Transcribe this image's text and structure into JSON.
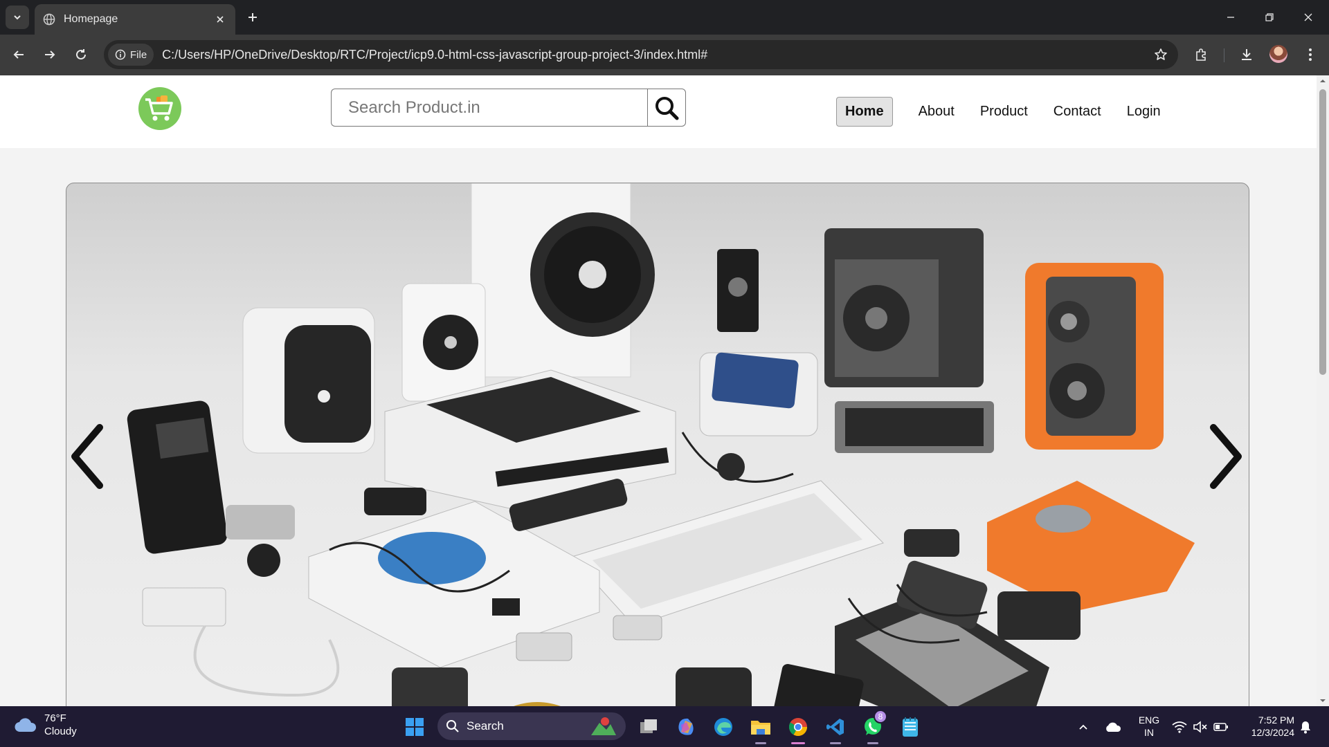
{
  "browser": {
    "tab_title": "Homepage",
    "url_scheme_label": "File",
    "url": "C:/Users/HP/OneDrive/Desktop/RTC/Project/icp9.0-html-css-javascript-group-project-3/index.html#"
  },
  "header": {
    "logo_icon": "shopping-cart-icon",
    "search_placeholder": "Search Product.in",
    "nav": [
      {
        "label": "Home",
        "active": true
      },
      {
        "label": "About",
        "active": false
      },
      {
        "label": "Product",
        "active": false
      },
      {
        "label": "Contact",
        "active": false
      },
      {
        "label": "Login",
        "active": false
      }
    ]
  },
  "slider": {
    "image_alt": "Assorted electronics: speakers, keyboards, gadgets",
    "prev_icon": "chevron-left-icon",
    "next_icon": "chevron-right-icon"
  },
  "taskbar": {
    "weather_temp": "76°F",
    "weather_desc": "Cloudy",
    "search_label": "Search",
    "whatsapp_badge": "8",
    "lang_top": "ENG",
    "lang_bottom": "IN",
    "time": "7:52 PM",
    "date": "12/3/2024"
  },
  "colors": {
    "browser_dark": "#202124",
    "toolbar": "#3c3c3c",
    "logo_green": "#7cc95a",
    "taskbar": "#1f1b33",
    "speaker_orange": "#f07a2c"
  }
}
